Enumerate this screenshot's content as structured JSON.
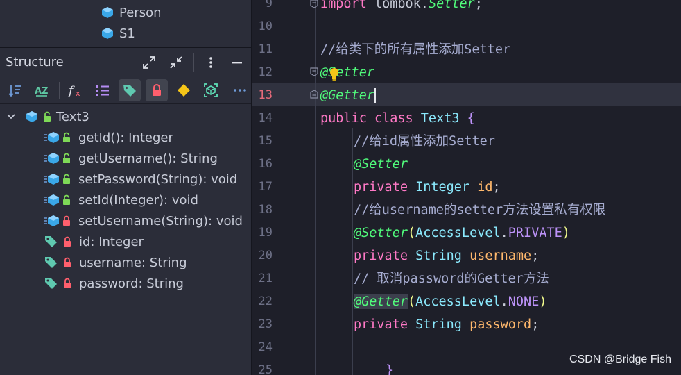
{
  "project": {
    "items": [
      {
        "label": "Person",
        "icon": "class-icon"
      },
      {
        "label": "S1",
        "icon": "class-icon"
      }
    ]
  },
  "structure": {
    "title": "Structure",
    "tree": {
      "root": {
        "label": "Text3"
      },
      "members": [
        {
          "label": "getId(): Integer",
          "kind": "method",
          "access": "public"
        },
        {
          "label": "getUsername(): String",
          "kind": "method",
          "access": "public"
        },
        {
          "label": "setPassword(String): void",
          "kind": "method",
          "access": "public"
        },
        {
          "label": "setId(Integer): void",
          "kind": "method",
          "access": "public"
        },
        {
          "label": "setUsername(String): void",
          "kind": "method",
          "access": "private"
        },
        {
          "label": "id: Integer",
          "kind": "field",
          "access": "private"
        },
        {
          "label": "username: String",
          "kind": "field",
          "access": "private"
        },
        {
          "label": "password: String",
          "kind": "field",
          "access": "private"
        }
      ]
    }
  },
  "editor": {
    "current_line": "13",
    "line_numbers": [
      "9",
      "10",
      "11",
      "12",
      "13",
      "14",
      "15",
      "16",
      "17",
      "18",
      "19",
      "20",
      "21",
      "22",
      "23",
      "24",
      "25"
    ],
    "code": {
      "l9_kw": "import",
      "l9_pkg": " lombok.",
      "l9_cls": "Setter",
      "l9_end": ";",
      "l11": "//给类下的所有属性添加Setter",
      "l12": "@Setter",
      "l13": "@Getter",
      "l14_kw": "public class ",
      "l14_cls": "Text3",
      "l14_end": " {",
      "l15": "//给id属性添加Setter",
      "l16": "@Setter",
      "l17_kw": "private ",
      "l17_type": "Integer ",
      "l17_fld": "id",
      "l17_end": ";",
      "l18": "//给username的setter方法设置私有权限",
      "l19_ann": "@Setter",
      "l19_p1": "(",
      "l19_cls": "AccessLevel",
      "l19_dot": ".",
      "l19_const": "PRIVATE",
      "l19_p2": ")",
      "l20_kw": "private ",
      "l20_type": "String ",
      "l20_fld": "username",
      "l20_end": ";",
      "l21": "// 取消password的Getter方法",
      "l22_ann": "@Getter",
      "l22_p1": "(",
      "l22_cls": "AccessLevel",
      "l22_dot": ".",
      "l22_const": "NONE",
      "l22_p2": ")",
      "l23_kw": "private ",
      "l23_type": "String ",
      "l23_fld": "password",
      "l23_end": ";",
      "l25": "}"
    }
  },
  "watermark": "CSDN @Bridge Fish",
  "colors": {
    "keyword": "#ff79c6",
    "class": "#8be9fd",
    "annotation": "#50fa7b",
    "comment": "#a6acd0",
    "field": "#ffb86c",
    "constant": "#bd93f9"
  }
}
